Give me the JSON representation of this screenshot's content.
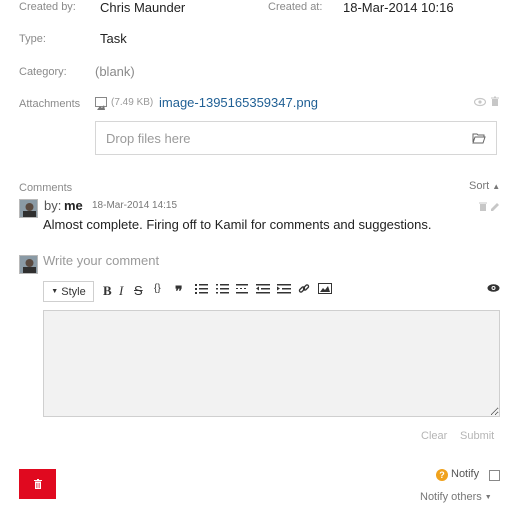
{
  "details": {
    "created_by_label": "Created by:",
    "created_by_value": "Chris Maunder",
    "created_at_label": "Created at:",
    "created_at_value": "18-Mar-2014 10:16",
    "type_label": "Type:",
    "type_value": "Task",
    "category_label": "Category:",
    "category_value": "(blank)",
    "attachments_label": "Attachments",
    "attachment_size": "(7.49 KB)",
    "attachment_name": "image-1395165359347.png",
    "dropzone_text": "Drop files here"
  },
  "comments": {
    "label": "Comments",
    "sort_label": "Sort",
    "items": [
      {
        "by_prefix": "by:",
        "author": "me",
        "timestamp": "18-Mar-2014 14:15",
        "text": "Almost complete. Firing off to Kamil for comments and suggestions."
      }
    ],
    "new_comment_placeholder": "Write your comment"
  },
  "editor": {
    "style_label": "Style",
    "toolbar": [
      "bold",
      "italic",
      "strikethrough",
      "code",
      "quote",
      "unordered-list",
      "ordered-list",
      "indent",
      "outdent-left",
      "outdent-right",
      "link",
      "image"
    ],
    "clear_label": "Clear",
    "submit_label": "Submit"
  },
  "footer": {
    "notify_label": "Notify",
    "notify_others_label": "Notify others"
  },
  "colors": {
    "delete_button": "#e0091f",
    "link": "#1f5f94",
    "help_icon": "#f0a21d"
  }
}
